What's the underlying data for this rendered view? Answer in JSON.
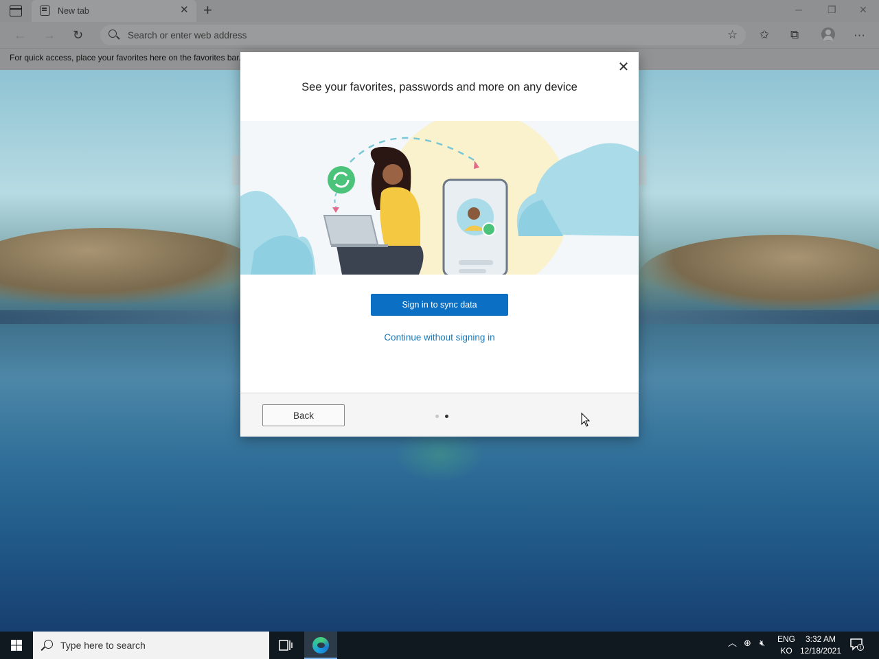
{
  "browser": {
    "tab_title": "New tab",
    "address_placeholder": "Search or enter web address",
    "favorites_bar_text": "For quick access, place your favorites here on the favorites bar."
  },
  "dialog": {
    "title": "See your favorites, passwords and more on any device",
    "primary_button": "Sign in to sync data",
    "secondary_link": "Continue without signing in",
    "back_button": "Back",
    "page_dots": {
      "total": 2,
      "active": 2
    }
  },
  "taskbar": {
    "search_placeholder": "Type here to search",
    "language_top": "ENG",
    "language_bottom": "KO",
    "time": "3:32 AM",
    "date": "12/18/2021",
    "notification_count": "1"
  },
  "colors": {
    "primary_button": "#0b6fc4",
    "link": "#1a78b8",
    "taskbar": "#101820"
  },
  "icons": [
    "tab-actions-icon",
    "tab-favicon-icon",
    "close-icon",
    "plus-icon",
    "back-arrow-icon",
    "forward-arrow-icon",
    "refresh-icon",
    "search-icon",
    "add-favorite-icon",
    "favorites-icon",
    "collections-icon",
    "profile-icon",
    "more-icon",
    "windows-logo-icon",
    "task-view-icon",
    "edge-icon",
    "chevron-up-icon",
    "network-icon",
    "volume-muted-icon",
    "notification-icon"
  ]
}
